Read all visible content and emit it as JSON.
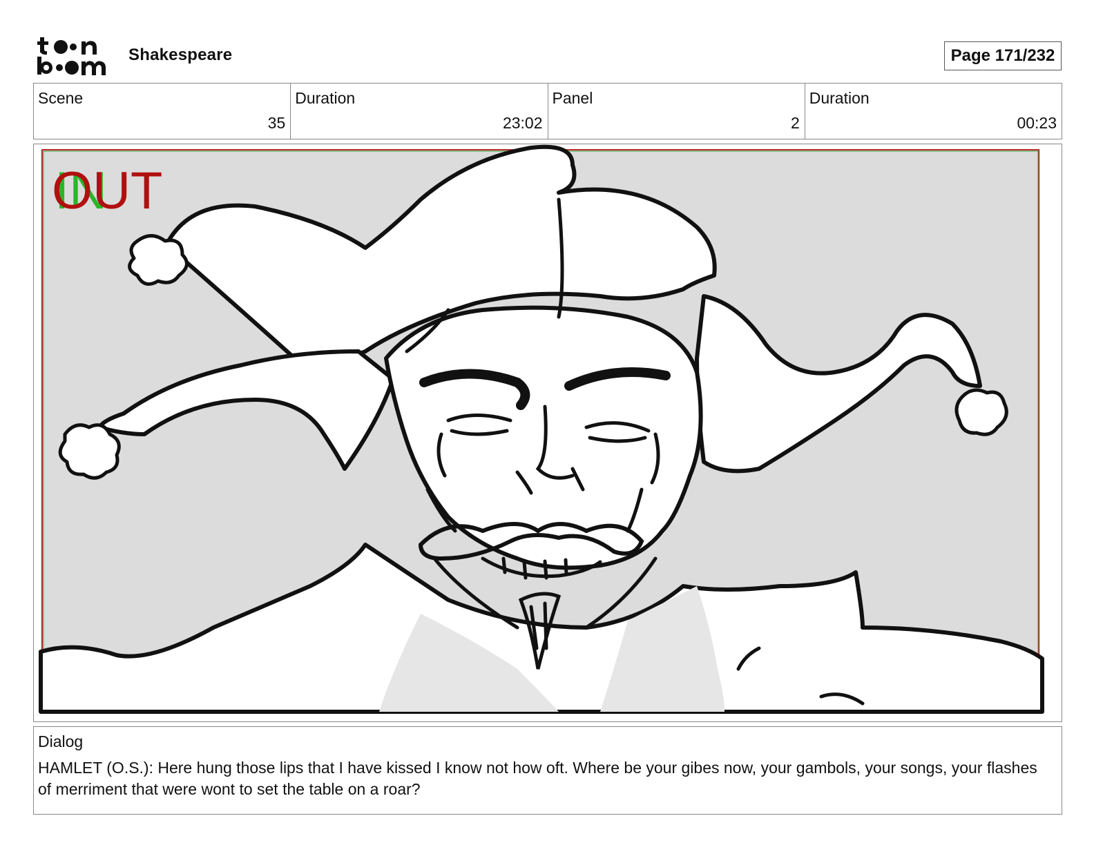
{
  "header": {
    "logo_top": "to•n",
    "logo_bottom": "b••m",
    "project_title": "Shakespeare",
    "page_indicator": "Page 171/232"
  },
  "info": {
    "scene_label": "Scene",
    "scene_value": "35",
    "scene_duration_label": "Duration",
    "scene_duration_value": "23:02",
    "panel_label": "Panel",
    "panel_value": "2",
    "panel_duration_label": "Duration",
    "panel_duration_value": "00:23"
  },
  "panel": {
    "in_marker": "IN",
    "out_marker": "OUT",
    "in_color": "#2bb52b",
    "out_color": "#b01010",
    "background_color": "#dcdcdc"
  },
  "dialog": {
    "label": "Dialog",
    "text": "HAMLET (O.S.): Here hung those lips that I have kissed I know not how oft.  Where be your gibes now, your gambols, your songs, your flashes of merriment that were wont to set the table on a roar?"
  }
}
